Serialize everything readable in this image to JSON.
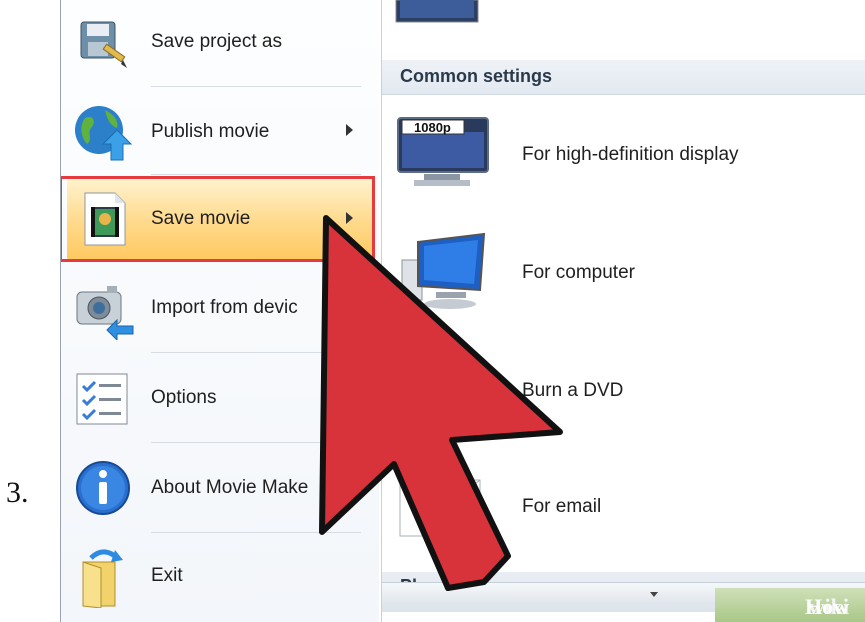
{
  "step_number": "3.",
  "menu": {
    "items": [
      {
        "label": "Save project as",
        "icon": "save-project-icon",
        "has_submenu": false
      },
      {
        "label": "Publish movie",
        "icon": "globe-publish-icon",
        "has_submenu": true
      },
      {
        "label": "Save movie",
        "icon": "film-save-icon",
        "has_submenu": true,
        "active": true
      },
      {
        "label": "Import from devic",
        "icon": "camera-import-icon",
        "has_submenu": false
      },
      {
        "label": "Options",
        "icon": "checklist-icon",
        "has_submenu": false
      },
      {
        "label": "About Movie Make",
        "icon": "info-icon",
        "has_submenu": false
      },
      {
        "label": "Exit",
        "icon": "exit-folder-icon",
        "has_submenu": false
      }
    ]
  },
  "submenu": {
    "section_title": "Common settings",
    "options": [
      {
        "label": "For high-definition display",
        "icon": "hd-monitor-icon",
        "badge": "1080p"
      },
      {
        "label": "For computer",
        "icon": "computer-icon"
      },
      {
        "label": "Burn a DVD",
        "icon": "dvd-icon"
      },
      {
        "label": "For email",
        "icon": "email-icon"
      }
    ],
    "bottom_section_partial": "Ph"
  },
  "colors": {
    "highlight_border": "#e53b3f",
    "active_item": "#ffd98a",
    "pointer_fill": "#d8323a"
  },
  "watermark": {
    "wiki": "wiki",
    "how": "How"
  }
}
